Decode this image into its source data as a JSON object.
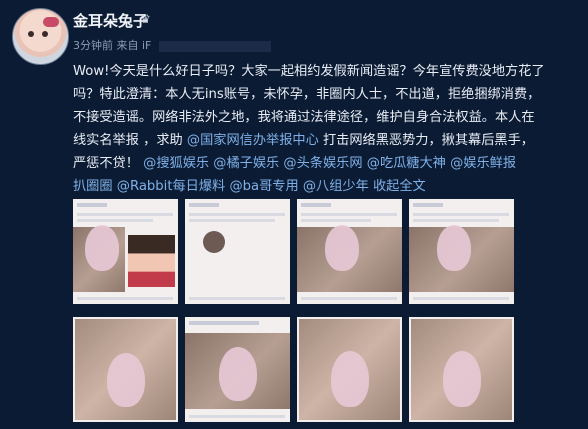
{
  "post": {
    "author": "金耳朵兔子",
    "verified_icon": "crown-badge-icon",
    "time": "3分钟前",
    "via_prefix": "来自 iF",
    "content_lines": [
      "Wow!今天是什么好日子吗？大家一起相约发假新闻造谣？今年宣传费没地方花了",
      "吗？特此澄清：本人无ins账号，未怀孕，非圈内人士，不出道，拒绝捆绑消费，",
      "不接受造谣。网络非法外之地，我将通过法律途径，维护自身合法权益。本人在",
      "线实名举报 ，求助"
    ],
    "tags_line4": [
      "@国家网信办举报中心"
    ],
    "after_line4": " 打击网络黑恶势力，揪其幕后黑手，",
    "line5_prefix": "严惩不贷！",
    "tags_line5": [
      "@搜狐娱乐",
      "@橘子娱乐",
      "@头条娱乐网",
      "@吃瓜糖大神",
      "@娱乐鲜报"
    ],
    "tags_line6": [
      "扒圈圈",
      "@Rabbit每日爆料",
      "@ba哥专用",
      "@八组少年"
    ],
    "expand_label": "收起全文"
  },
  "colors": {
    "background": "#0b1b33",
    "link": "#7fb1e8"
  }
}
